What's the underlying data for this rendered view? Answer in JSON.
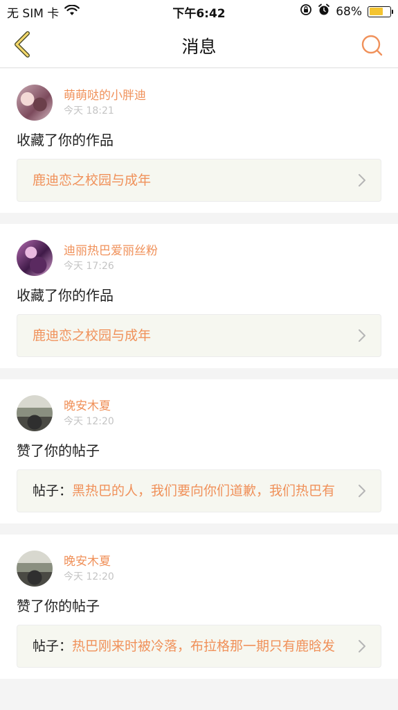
{
  "status_bar": {
    "carrier": "无 SIM 卡",
    "time": "下午6:42",
    "battery": "68%",
    "battery_level": 0.68,
    "battery_color": "#f4c430",
    "icons": [
      "wifi-icon",
      "orientation-lock-icon",
      "alarm-icon",
      "battery-icon"
    ]
  },
  "nav": {
    "title": "消息",
    "back_icon": "chevron-left-icon",
    "search_icon": "search-icon",
    "accent": "#f0915a"
  },
  "messages": [
    {
      "username": "萌萌哒的小胖迪",
      "time": "今天 18:21",
      "action": "收藏了你的作品",
      "ref_prefix": "",
      "ref_text": "鹿迪恋之校园与成年"
    },
    {
      "username": "迪丽热巴爱丽丝粉",
      "time": "今天 17:26",
      "action": "收藏了你的作品",
      "ref_prefix": "",
      "ref_text": "鹿迪恋之校园与成年"
    },
    {
      "username": "晚安木夏",
      "time": "今天 12:20",
      "action": "赞了你的帖子",
      "ref_prefix": "帖子：",
      "ref_text": "黑热巴的人，我们要向你们道歉，我们热巴有"
    },
    {
      "username": "晚安木夏",
      "time": "今天 12:20",
      "action": "赞了你的帖子",
      "ref_prefix": "帖子：",
      "ref_text": "热巴刚来时被冷落，布拉格那一期只有鹿晗发"
    }
  ]
}
